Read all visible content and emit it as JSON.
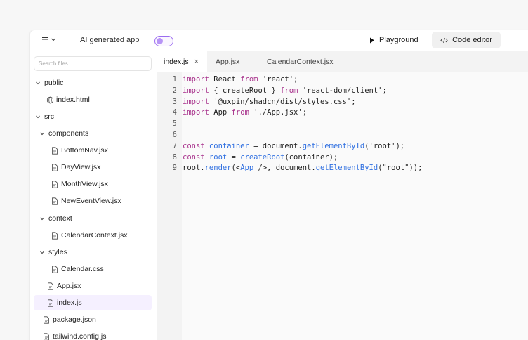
{
  "topbar": {
    "app_title": "AI generated app",
    "playground_label": "Playground",
    "code_editor_label": "Code editor",
    "accent": "#9b6cf0"
  },
  "sidebar": {
    "search_placeholder": "Search files...",
    "items": [
      {
        "label": "public",
        "kind": "folder",
        "expanded": true
      },
      {
        "label": "index.html",
        "kind": "html"
      },
      {
        "label": "src",
        "kind": "folder",
        "expanded": true
      },
      {
        "label": "components",
        "kind": "folder",
        "expanded": true
      },
      {
        "label": "BottomNav.jsx",
        "kind": "file"
      },
      {
        "label": "DayView.jsx",
        "kind": "file"
      },
      {
        "label": "MonthView.jsx",
        "kind": "file"
      },
      {
        "label": "NewEventView.jsx",
        "kind": "file"
      },
      {
        "label": "context",
        "kind": "folder",
        "expanded": true
      },
      {
        "label": "CalendarContext.jsx",
        "kind": "file"
      },
      {
        "label": "styles",
        "kind": "folder",
        "expanded": true
      },
      {
        "label": "Calendar.css",
        "kind": "file"
      },
      {
        "label": "App.jsx",
        "kind": "file"
      },
      {
        "label": "index.js",
        "kind": "file",
        "selected": true
      },
      {
        "label": "package.json",
        "kind": "file"
      },
      {
        "label": "tailwind.config.js",
        "kind": "file"
      }
    ]
  },
  "tabs": [
    {
      "label": "index.js",
      "active": true,
      "close": "×"
    },
    {
      "label": "App.jsx"
    },
    {
      "label": "CalendarContext.jsx"
    }
  ],
  "code": {
    "lines": [
      {
        "n": "1",
        "tokens": [
          [
            "kw",
            "import"
          ],
          [
            "pl",
            " React "
          ],
          [
            "kw",
            "from"
          ],
          [
            "str",
            " 'react'"
          ],
          [
            "pl",
            ";"
          ]
        ]
      },
      {
        "n": "2",
        "tokens": [
          [
            "kw",
            "import"
          ],
          [
            "pl",
            " { createRoot } "
          ],
          [
            "kw",
            "from"
          ],
          [
            "str",
            " 'react-dom/client'"
          ],
          [
            "pl",
            ";"
          ]
        ]
      },
      {
        "n": "3",
        "tokens": [
          [
            "kw",
            "import"
          ],
          [
            "str",
            " '@uxpin/shadcn/dist/styles.css'"
          ],
          [
            "pl",
            ";"
          ]
        ]
      },
      {
        "n": "4",
        "tokens": [
          [
            "kw",
            "import"
          ],
          [
            "pl",
            " App "
          ],
          [
            "kw",
            "from"
          ],
          [
            "str",
            " './App.jsx'"
          ],
          [
            "pl",
            ";"
          ]
        ]
      },
      {
        "n": "5",
        "tokens": []
      },
      {
        "n": "6",
        "tokens": []
      },
      {
        "n": "7",
        "tokens": [
          [
            "kw",
            "const"
          ],
          [
            "def",
            " container"
          ],
          [
            "pl",
            " = document."
          ],
          [
            "fn",
            "getElementById"
          ],
          [
            "pl",
            "("
          ],
          [
            "str",
            "'root'"
          ],
          [
            "pl",
            ");"
          ]
        ]
      },
      {
        "n": "8",
        "tokens": [
          [
            "kw",
            "const"
          ],
          [
            "def",
            " root"
          ],
          [
            "pl",
            " = "
          ],
          [
            "fn",
            "createRoot"
          ],
          [
            "pl",
            "(container);"
          ]
        ]
      },
      {
        "n": "9",
        "tokens": [
          [
            "pl",
            "root."
          ],
          [
            "fn",
            "render"
          ],
          [
            "pl",
            "(<"
          ],
          [
            "tg",
            "App"
          ],
          [
            "pl",
            " />, document."
          ],
          [
            "fn",
            "getElementById"
          ],
          [
            "pl",
            "("
          ],
          [
            "str",
            "\"root\""
          ],
          [
            "pl",
            "));"
          ]
        ]
      }
    ]
  }
}
